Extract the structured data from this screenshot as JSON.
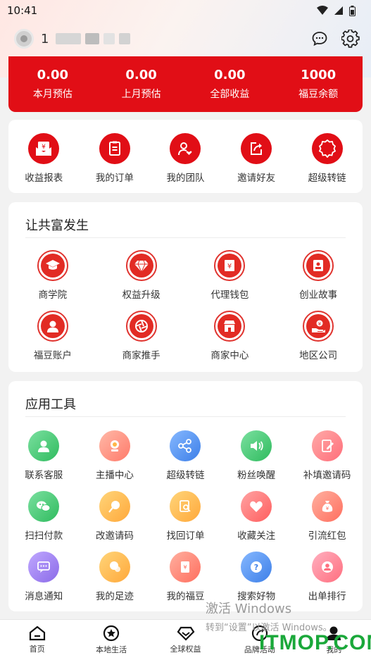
{
  "status": {
    "time": "10:41"
  },
  "header": {
    "username": "1"
  },
  "earnings": [
    {
      "value": "0.00",
      "label": "本月预估"
    },
    {
      "value": "0.00",
      "label": "上月预估"
    },
    {
      "value": "0.00",
      "label": "全部收益"
    },
    {
      "value": "1000",
      "label": "福豆余额"
    }
  ],
  "quick_menu": [
    {
      "label": "收益报表",
      "icon": "income-report-icon"
    },
    {
      "label": "我的订单",
      "icon": "order-list-icon"
    },
    {
      "label": "我的团队",
      "icon": "team-heart-icon"
    },
    {
      "label": "邀请好友",
      "icon": "share-arrow-icon"
    },
    {
      "label": "超级转链",
      "icon": "badge-icon"
    }
  ],
  "common_wealth": {
    "title": "让共富发生",
    "items": [
      {
        "label": "商学院",
        "icon": "graduation-cap-icon"
      },
      {
        "label": "权益升级",
        "icon": "diamond-icon"
      },
      {
        "label": "代理钱包",
        "icon": "wallet-icon"
      },
      {
        "label": "创业故事",
        "icon": "story-book-icon"
      },
      {
        "label": "福豆账户",
        "icon": "account-user-icon"
      },
      {
        "label": "商家推手",
        "icon": "aperture-icon"
      },
      {
        "label": "商家中心",
        "icon": "shop-icon"
      },
      {
        "label": "地区公司",
        "icon": "hand-coin-icon"
      }
    ]
  },
  "tools": {
    "title": "应用工具",
    "items": [
      {
        "label": "联系客服",
        "icon": "customer-service-icon",
        "color": "#4cc97a"
      },
      {
        "label": "主播中心",
        "icon": "camera-icon",
        "color": "#ff8f7a"
      },
      {
        "label": "超级转链",
        "icon": "share-nodes-icon",
        "color": "#4a8ff0"
      },
      {
        "label": "粉丝唤醒",
        "icon": "speaker-icon",
        "color": "#4cc97a"
      },
      {
        "label": "补填邀请码",
        "icon": "edit-icon",
        "color": "#ff7f7f"
      },
      {
        "label": "扫扫付款",
        "icon": "wechat-icon",
        "color": "#4cc97a"
      },
      {
        "label": "改邀请码",
        "icon": "lollipop-icon",
        "color": "#ffb648"
      },
      {
        "label": "找回订单",
        "icon": "search-doc-icon",
        "color": "#ffb648"
      },
      {
        "label": "收藏关注",
        "icon": "heart-icon",
        "color": "#ff6e6e"
      },
      {
        "label": "引流红包",
        "icon": "money-bag-icon",
        "color": "#ff7a6a"
      },
      {
        "label": "消息通知",
        "icon": "message-icon",
        "color": "#9a7cf0"
      },
      {
        "label": "我的足迹",
        "icon": "footprint-icon",
        "color": "#ffb648"
      },
      {
        "label": "我的福豆",
        "icon": "bean-bag-icon",
        "color": "#ff7a6a"
      },
      {
        "label": "搜索好物",
        "icon": "question-icon",
        "color": "#4a8ff0"
      },
      {
        "label": "出单排行",
        "icon": "rank-user-icon",
        "color": "#ff7a8a"
      }
    ]
  },
  "bottom_nav": [
    {
      "label": "首页",
      "icon": "home-icon"
    },
    {
      "label": "本地生活",
      "icon": "local-star-icon"
    },
    {
      "label": "全球权益",
      "icon": "global-diamond-icon"
    },
    {
      "label": "品牌活动",
      "icon": "brand-icon"
    },
    {
      "label": "我的",
      "icon": "mine-icon"
    }
  ],
  "watermark": {
    "line1": "激活 Windows",
    "line2": "转到“设置”以激活 Windows。",
    "logo": "ITMOP.COM"
  },
  "colors": {
    "primary": "#e10e16",
    "background": "#f2f2f2"
  }
}
